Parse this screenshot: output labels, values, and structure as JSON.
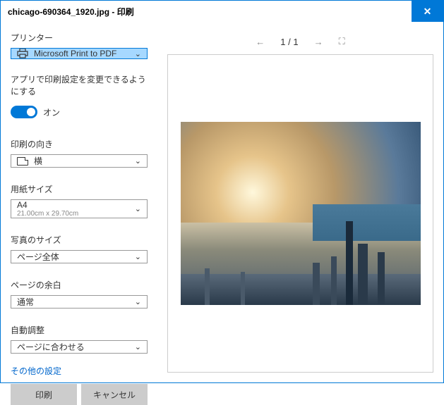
{
  "window": {
    "title": "chicago-690364_1920.jpg - 印刷"
  },
  "left": {
    "printer_label": "プリンター",
    "printer_name": "Microsoft Print to PDF",
    "app_toggle_label": "アプリで印刷設定を変更できるようにする",
    "toggle_state": "オン",
    "orientation_label": "印刷の向き",
    "orientation_value": "横",
    "paper_label": "用紙サイズ",
    "paper_value": "A4",
    "paper_sub": "21.00cm x 29.70cm",
    "photo_size_label": "写真のサイズ",
    "photo_size_value": "ページ全体",
    "margin_label": "ページの余白",
    "margin_value": "通常",
    "fit_label": "自動調整",
    "fit_value": "ページに合わせる",
    "more_link": "その他の設定",
    "print_btn": "印刷",
    "cancel_btn": "キャンセル"
  },
  "pager": {
    "current": "1",
    "sep": "/",
    "total": "1"
  }
}
